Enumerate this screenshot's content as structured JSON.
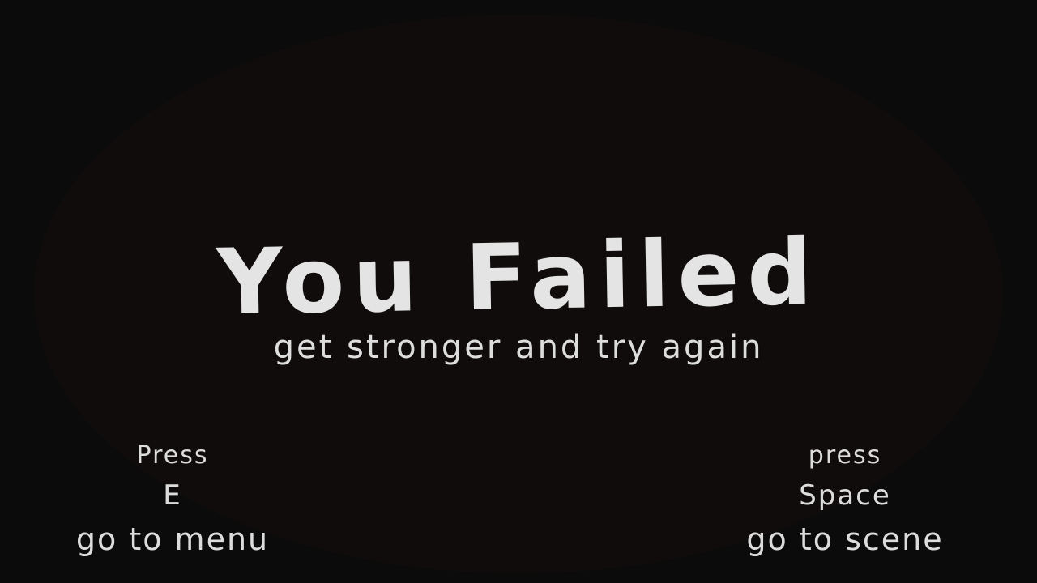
{
  "title": "You Failed",
  "subtitle": "get stronger and try again",
  "left_hint": {
    "press": "Press",
    "key": "E",
    "action": "go to menu"
  },
  "right_hint": {
    "press": "press",
    "key": "Space",
    "action": "go to scene"
  },
  "colors": {
    "background": "#0b0b0b",
    "vignette": "#110c0c",
    "text": "#e4e4e4"
  }
}
